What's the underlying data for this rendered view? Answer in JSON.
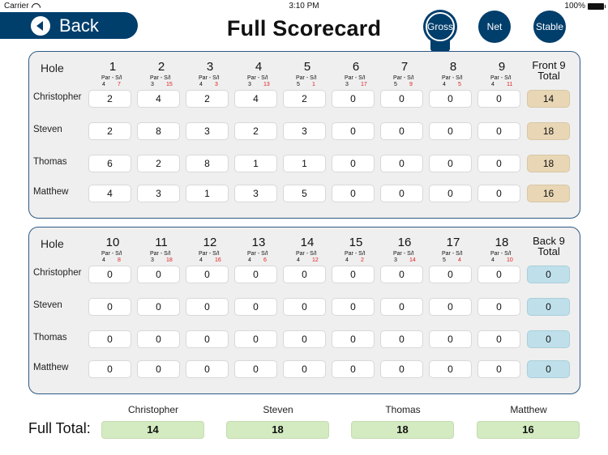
{
  "status_bar": {
    "carrier": "Carrier",
    "time": "3:10 PM",
    "battery": "100%"
  },
  "header": {
    "back_label": "Back",
    "title": "Full Scorecard",
    "tabs": [
      {
        "label": "Gross",
        "selected": true
      },
      {
        "label": "Net",
        "selected": false
      },
      {
        "label": "Stable",
        "selected": false
      }
    ]
  },
  "labels": {
    "hole": "Hole",
    "par": "Par",
    "dash": "-",
    "si": "S/I"
  },
  "front9": {
    "total_label_1": "Front 9",
    "total_label_2": "Total",
    "holes": [
      {
        "num": "1",
        "par": "4",
        "si": "7"
      },
      {
        "num": "2",
        "par": "3",
        "si": "15"
      },
      {
        "num": "3",
        "par": "4",
        "si": "3"
      },
      {
        "num": "4",
        "par": "3",
        "si": "13"
      },
      {
        "num": "5",
        "par": "5",
        "si": "1"
      },
      {
        "num": "6",
        "par": "3",
        "si": "17"
      },
      {
        "num": "7",
        "par": "5",
        "si": "9"
      },
      {
        "num": "8",
        "par": "4",
        "si": "5"
      },
      {
        "num": "9",
        "par": "4",
        "si": "11"
      }
    ],
    "players": [
      {
        "name": "Christopher",
        "scores": [
          "2",
          "4",
          "2",
          "4",
          "2",
          "0",
          "0",
          "0",
          "0"
        ],
        "total": "14"
      },
      {
        "name": "Steven",
        "scores": [
          "2",
          "8",
          "3",
          "2",
          "3",
          "0",
          "0",
          "0",
          "0"
        ],
        "total": "18"
      },
      {
        "name": "Thomas",
        "scores": [
          "6",
          "2",
          "8",
          "1",
          "1",
          "0",
          "0",
          "0",
          "0"
        ],
        "total": "18"
      },
      {
        "name": "Matthew",
        "scores": [
          "4",
          "3",
          "1",
          "3",
          "5",
          "0",
          "0",
          "0",
          "0"
        ],
        "total": "16"
      }
    ]
  },
  "back9": {
    "total_label_1": "Back 9",
    "total_label_2": "Total",
    "holes": [
      {
        "num": "10",
        "par": "4",
        "si": "8"
      },
      {
        "num": "11",
        "par": "3",
        "si": "18"
      },
      {
        "num": "12",
        "par": "4",
        "si": "16"
      },
      {
        "num": "13",
        "par": "4",
        "si": "6"
      },
      {
        "num": "14",
        "par": "4",
        "si": "12"
      },
      {
        "num": "15",
        "par": "4",
        "si": "2"
      },
      {
        "num": "16",
        "par": "3",
        "si": "14"
      },
      {
        "num": "17",
        "par": "5",
        "si": "4"
      },
      {
        "num": "18",
        "par": "4",
        "si": "10"
      }
    ],
    "players": [
      {
        "name": "Christopher",
        "scores": [
          "0",
          "0",
          "0",
          "0",
          "0",
          "0",
          "0",
          "0",
          "0"
        ],
        "total": "0"
      },
      {
        "name": "Steven",
        "scores": [
          "0",
          "0",
          "0",
          "0",
          "0",
          "0",
          "0",
          "0",
          "0"
        ],
        "total": "0"
      },
      {
        "name": "Thomas",
        "scores": [
          "0",
          "0",
          "0",
          "0",
          "0",
          "0",
          "0",
          "0",
          "0"
        ],
        "total": "0"
      },
      {
        "name": "Matthew",
        "scores": [
          "0",
          "0",
          "0",
          "0",
          "0",
          "0",
          "0",
          "0",
          "0"
        ],
        "total": "0"
      }
    ]
  },
  "footer": {
    "full_total_label": "Full Total:",
    "players": [
      {
        "name": "Christopher",
        "total": "14"
      },
      {
        "name": "Steven",
        "total": "18"
      },
      {
        "name": "Thomas",
        "total": "18"
      },
      {
        "name": "Matthew",
        "total": "16"
      }
    ]
  },
  "colors": {
    "brand_navy": "#003e6c",
    "front_total_bg": "#e8d6b5",
    "back_total_bg": "#bfe0ea",
    "full_total_bg": "#d4eac1",
    "stroke_index": "#e02020"
  }
}
